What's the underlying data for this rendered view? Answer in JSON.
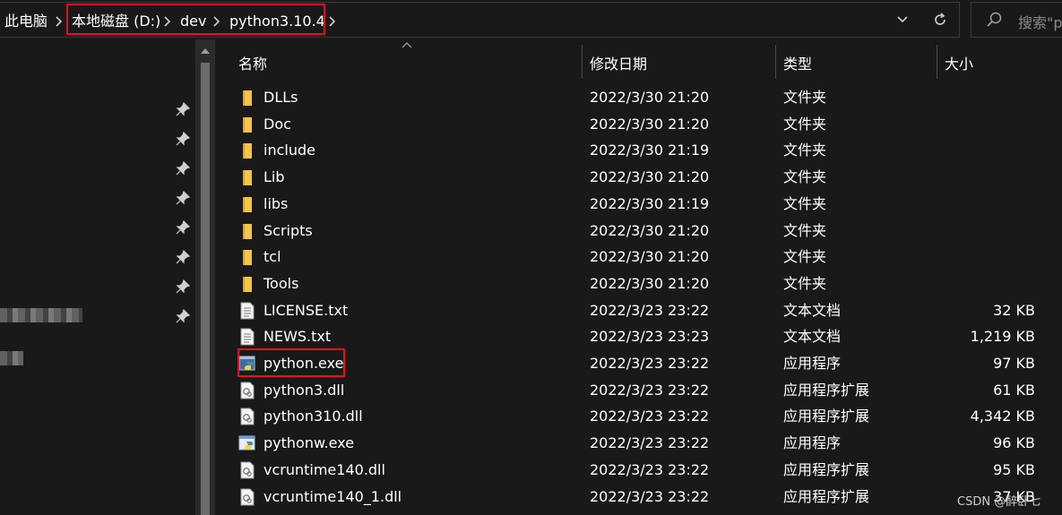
{
  "breadcrumb": {
    "items": [
      "此电脑",
      "本地磁盘 (D:)",
      "dev",
      "python3.10.4"
    ]
  },
  "search": {
    "placeholder": "搜索\"p"
  },
  "columns": {
    "name": "名称",
    "date": "修改日期",
    "type": "类型",
    "size": "大小"
  },
  "files": [
    {
      "name": "DLLs",
      "date": "2022/3/30 21:20",
      "type": "文件夹",
      "size": "",
      "icon": "folder-icon"
    },
    {
      "name": "Doc",
      "date": "2022/3/30 21:20",
      "type": "文件夹",
      "size": "",
      "icon": "folder-icon"
    },
    {
      "name": "include",
      "date": "2022/3/30 21:19",
      "type": "文件夹",
      "size": "",
      "icon": "folder-icon"
    },
    {
      "name": "Lib",
      "date": "2022/3/30 21:20",
      "type": "文件夹",
      "size": "",
      "icon": "folder-icon"
    },
    {
      "name": "libs",
      "date": "2022/3/30 21:19",
      "type": "文件夹",
      "size": "",
      "icon": "folder-icon"
    },
    {
      "name": "Scripts",
      "date": "2022/3/30 21:20",
      "type": "文件夹",
      "size": "",
      "icon": "folder-icon"
    },
    {
      "name": "tcl",
      "date": "2022/3/30 21:20",
      "type": "文件夹",
      "size": "",
      "icon": "folder-icon"
    },
    {
      "name": "Tools",
      "date": "2022/3/30 21:20",
      "type": "文件夹",
      "size": "",
      "icon": "folder-icon"
    },
    {
      "name": "LICENSE.txt",
      "date": "2022/3/23 23:22",
      "type": "文本文档",
      "size": "32 KB",
      "icon": "text-file-icon"
    },
    {
      "name": "NEWS.txt",
      "date": "2022/3/23 23:23",
      "type": "文本文档",
      "size": "1,219 KB",
      "icon": "text-file-icon"
    },
    {
      "name": "python.exe",
      "date": "2022/3/23 23:22",
      "type": "应用程序",
      "size": "97 KB",
      "icon": "python-exe-icon"
    },
    {
      "name": "python3.dll",
      "date": "2022/3/23 23:22",
      "type": "应用程序扩展",
      "size": "61 KB",
      "icon": "dll-icon"
    },
    {
      "name": "python310.dll",
      "date": "2022/3/23 23:22",
      "type": "应用程序扩展",
      "size": "4,342 KB",
      "icon": "dll-icon"
    },
    {
      "name": "pythonw.exe",
      "date": "2022/3/23 23:22",
      "type": "应用程序",
      "size": "96 KB",
      "icon": "pythonw-exe-icon"
    },
    {
      "name": "vcruntime140.dll",
      "date": "2022/3/23 23:22",
      "type": "应用程序扩展",
      "size": "95 KB",
      "icon": "dll-icon"
    },
    {
      "name": "vcruntime140_1.dll",
      "date": "2022/3/23 23:22",
      "type": "应用程序扩展",
      "size": "37 KB",
      "icon": "dll-icon"
    }
  ],
  "watermark": "CSDN @醉卧七",
  "colors": {
    "background": "#191919",
    "highlight": "#e81123",
    "folder": "#f8c444"
  }
}
